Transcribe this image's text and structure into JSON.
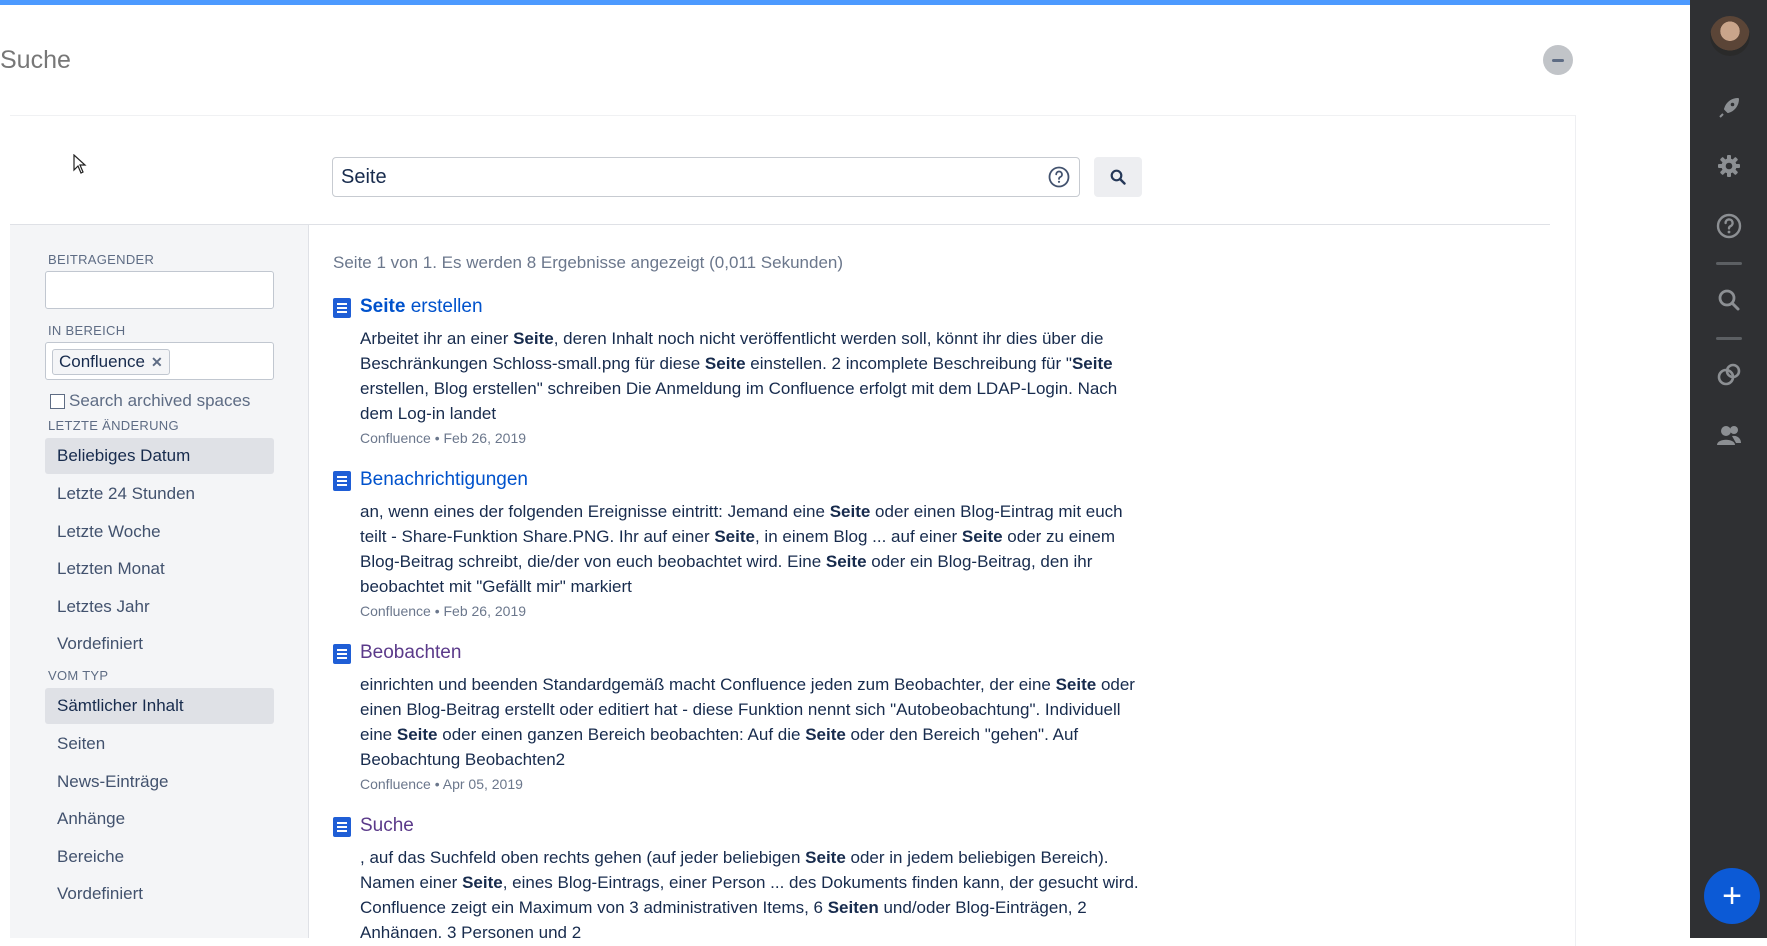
{
  "header": {
    "title": "Suche"
  },
  "search": {
    "query": "Seite"
  },
  "sidebar": {
    "contributor_label": "BEITRAGENDER",
    "space_label": "IN BEREICH",
    "space_tag": "Confluence",
    "archived_label": "Search archived spaces",
    "date_label": "LETZTE ÄNDERUNG",
    "date_options": [
      "Beliebiges Datum",
      "Letzte 24 Stunden",
      "Letzte Woche",
      "Letzten Monat",
      "Letztes Jahr",
      "Vordefiniert"
    ],
    "type_label": "VOM TYP",
    "type_options": [
      "Sämtlicher Inhalt",
      "Seiten",
      "News-Einträge",
      "Anhänge",
      "Bereiche",
      "Vordefiniert"
    ]
  },
  "results": {
    "summary": "Seite 1 von 1. Es werden 8 Ergebnisse angezeigt (0,011 Sekunden)",
    "items": [
      {
        "title_bold": "Seite",
        "title_rest": " erstellen",
        "excerpt_parts": [
          "Arbeitet ihr an einer ",
          "Seite",
          ", deren Inhalt noch nicht veröffentlicht werden soll, könnt ihr dies über die Beschränkungen Schloss-small.png für diese ",
          "Seite",
          " einstellen. 2 incomplete Beschreibung für \"",
          "Seite",
          " erstellen, Blog erstellen\" schreiben Die Anmeldung im Confluence erfolgt mit dem LDAP-Login. Nach dem Log-in landet"
        ],
        "meta": "Confluence • Feb 26, 2019"
      },
      {
        "title_bold": "",
        "title_rest": "Benachrichtigungen",
        "excerpt_parts": [
          "an, wenn eines der folgenden Ereignisse eintritt: Jemand eine ",
          "Seite",
          " oder einen Blog-Eintrag mit euch teilt - Share-Funktion Share.PNG. Ihr auf einer ",
          "Seite",
          ", in einem Blog ... auf einer ",
          "Seite",
          " oder zu einem Blog-Beitrag schreibt, die/der von euch beobachtet wird. Eine ",
          "Seite",
          " oder ein Blog-Beitrag, den ihr beobachtet mit \"Gefällt mir\" markiert"
        ],
        "meta": "Confluence • Feb 26, 2019"
      },
      {
        "title_bold": "",
        "title_rest": "Beobachten",
        "excerpt_parts": [
          "einrichten und beenden Standardgemäß macht Confluence jeden zum Beobachter, der eine ",
          "Seite",
          " oder einen Blog-Beitrag erstellt oder editiert hat - diese Funktion nennt sich \"Autobeobachtung\". Individuell eine ",
          "Seite",
          " oder einen ganzen Bereich beobachten: Auf die ",
          "Seite",
          " oder den Bereich \"gehen\". Auf Beobachtung Beobachten2"
        ],
        "meta": "Confluence • Apr 05, 2019"
      },
      {
        "title_bold": "",
        "title_rest": "Suche",
        "excerpt_parts": [
          ", auf das Suchfeld oben rechts gehen (auf jeder beliebigen ",
          "Seite",
          " oder in jedem beliebigen Bereich). Namen einer ",
          "Seite",
          ", eines Blog-Eintrags, einer Person ... des Dokuments finden kann, der gesucht wird. Confluence zeigt ein Maximum von 3 administrativen Items, 6 ",
          "Seiten",
          " und/oder Blog-Einträgen, 2 Anhängen, 3 Personen und 2"
        ],
        "meta": ""
      }
    ]
  },
  "colors": {
    "accent": "#0052cc",
    "rail": "#2f3033",
    "fab": "#0c5ad6"
  }
}
